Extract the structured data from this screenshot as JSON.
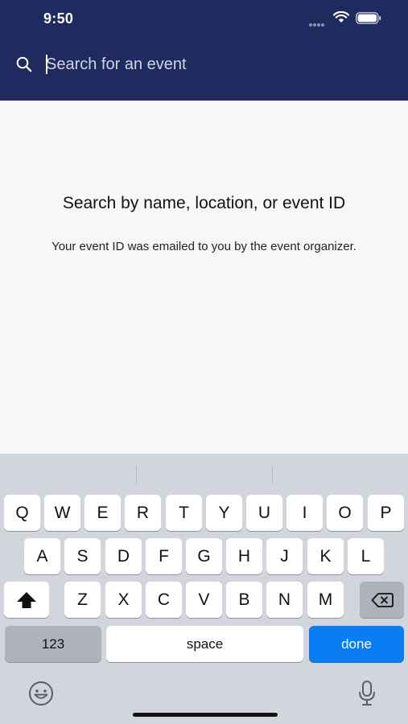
{
  "status_bar": {
    "time": "9:50"
  },
  "search": {
    "placeholder": "Search for an event",
    "value": ""
  },
  "empty_state": {
    "title": "Search by name, location, or event ID",
    "subtitle": "Your event ID was emailed to you by the event organizer."
  },
  "keyboard": {
    "row1": [
      "Q",
      "W",
      "E",
      "R",
      "T",
      "Y",
      "U",
      "I",
      "O",
      "P"
    ],
    "row2": [
      "A",
      "S",
      "D",
      "F",
      "G",
      "H",
      "J",
      "K",
      "L"
    ],
    "row3": [
      "Z",
      "X",
      "C",
      "V",
      "B",
      "N",
      "M"
    ],
    "numbers_label": "123",
    "space_label": "space",
    "done_label": "done"
  },
  "colors": {
    "header": "#1f2b5e",
    "done_key": "#0a7cf4",
    "keyboard_bg": "#d2d5db"
  },
  "icons": [
    "search-icon",
    "wifi-icon",
    "battery-icon",
    "shift-icon",
    "delete-icon",
    "emoji-icon",
    "microphone-icon"
  ]
}
